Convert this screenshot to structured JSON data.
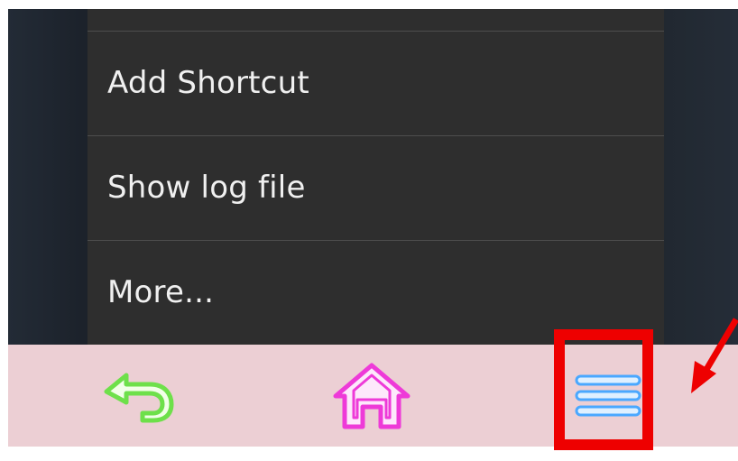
{
  "menu": {
    "items": [
      {
        "label": "Add Shortcut"
      },
      {
        "label": "Show log file"
      },
      {
        "label": "More..."
      }
    ]
  },
  "navbar": {
    "back_icon": "back-arrow-icon",
    "home_icon": "home-icon",
    "menu_icon": "hamburger-menu-icon"
  },
  "colors": {
    "menu_background": "#2e2e2e",
    "menu_text": "#f0f0f0",
    "navbar_background": "#eccfd4",
    "back_icon": "#6ee04a",
    "home_icon": "#ee3ad8",
    "menu_icon": "#4aa8ff",
    "annotation": "#ee0000"
  }
}
